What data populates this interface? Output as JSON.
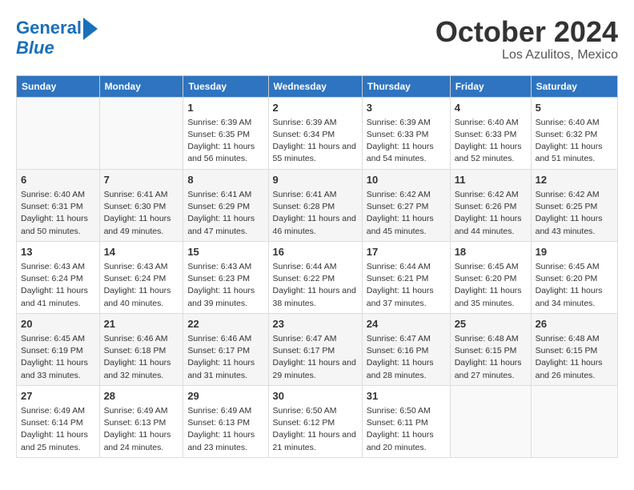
{
  "logo": {
    "line1": "General",
    "line2": "Blue"
  },
  "title": "October 2024",
  "subtitle": "Los Azulitos, Mexico",
  "days_of_week": [
    "Sunday",
    "Monday",
    "Tuesday",
    "Wednesday",
    "Thursday",
    "Friday",
    "Saturday"
  ],
  "weeks": [
    [
      {
        "day": "",
        "info": ""
      },
      {
        "day": "",
        "info": ""
      },
      {
        "day": "1",
        "info": "Sunrise: 6:39 AM\nSunset: 6:35 PM\nDaylight: 11 hours and 56 minutes."
      },
      {
        "day": "2",
        "info": "Sunrise: 6:39 AM\nSunset: 6:34 PM\nDaylight: 11 hours and 55 minutes."
      },
      {
        "day": "3",
        "info": "Sunrise: 6:39 AM\nSunset: 6:33 PM\nDaylight: 11 hours and 54 minutes."
      },
      {
        "day": "4",
        "info": "Sunrise: 6:40 AM\nSunset: 6:33 PM\nDaylight: 11 hours and 52 minutes."
      },
      {
        "day": "5",
        "info": "Sunrise: 6:40 AM\nSunset: 6:32 PM\nDaylight: 11 hours and 51 minutes."
      }
    ],
    [
      {
        "day": "6",
        "info": "Sunrise: 6:40 AM\nSunset: 6:31 PM\nDaylight: 11 hours and 50 minutes."
      },
      {
        "day": "7",
        "info": "Sunrise: 6:41 AM\nSunset: 6:30 PM\nDaylight: 11 hours and 49 minutes."
      },
      {
        "day": "8",
        "info": "Sunrise: 6:41 AM\nSunset: 6:29 PM\nDaylight: 11 hours and 47 minutes."
      },
      {
        "day": "9",
        "info": "Sunrise: 6:41 AM\nSunset: 6:28 PM\nDaylight: 11 hours and 46 minutes."
      },
      {
        "day": "10",
        "info": "Sunrise: 6:42 AM\nSunset: 6:27 PM\nDaylight: 11 hours and 45 minutes."
      },
      {
        "day": "11",
        "info": "Sunrise: 6:42 AM\nSunset: 6:26 PM\nDaylight: 11 hours and 44 minutes."
      },
      {
        "day": "12",
        "info": "Sunrise: 6:42 AM\nSunset: 6:25 PM\nDaylight: 11 hours and 43 minutes."
      }
    ],
    [
      {
        "day": "13",
        "info": "Sunrise: 6:43 AM\nSunset: 6:24 PM\nDaylight: 11 hours and 41 minutes."
      },
      {
        "day": "14",
        "info": "Sunrise: 6:43 AM\nSunset: 6:24 PM\nDaylight: 11 hours and 40 minutes."
      },
      {
        "day": "15",
        "info": "Sunrise: 6:43 AM\nSunset: 6:23 PM\nDaylight: 11 hours and 39 minutes."
      },
      {
        "day": "16",
        "info": "Sunrise: 6:44 AM\nSunset: 6:22 PM\nDaylight: 11 hours and 38 minutes."
      },
      {
        "day": "17",
        "info": "Sunrise: 6:44 AM\nSunset: 6:21 PM\nDaylight: 11 hours and 37 minutes."
      },
      {
        "day": "18",
        "info": "Sunrise: 6:45 AM\nSunset: 6:20 PM\nDaylight: 11 hours and 35 minutes."
      },
      {
        "day": "19",
        "info": "Sunrise: 6:45 AM\nSunset: 6:20 PM\nDaylight: 11 hours and 34 minutes."
      }
    ],
    [
      {
        "day": "20",
        "info": "Sunrise: 6:45 AM\nSunset: 6:19 PM\nDaylight: 11 hours and 33 minutes."
      },
      {
        "day": "21",
        "info": "Sunrise: 6:46 AM\nSunset: 6:18 PM\nDaylight: 11 hours and 32 minutes."
      },
      {
        "day": "22",
        "info": "Sunrise: 6:46 AM\nSunset: 6:17 PM\nDaylight: 11 hours and 31 minutes."
      },
      {
        "day": "23",
        "info": "Sunrise: 6:47 AM\nSunset: 6:17 PM\nDaylight: 11 hours and 29 minutes."
      },
      {
        "day": "24",
        "info": "Sunrise: 6:47 AM\nSunset: 6:16 PM\nDaylight: 11 hours and 28 minutes."
      },
      {
        "day": "25",
        "info": "Sunrise: 6:48 AM\nSunset: 6:15 PM\nDaylight: 11 hours and 27 minutes."
      },
      {
        "day": "26",
        "info": "Sunrise: 6:48 AM\nSunset: 6:15 PM\nDaylight: 11 hours and 26 minutes."
      }
    ],
    [
      {
        "day": "27",
        "info": "Sunrise: 6:49 AM\nSunset: 6:14 PM\nDaylight: 11 hours and 25 minutes."
      },
      {
        "day": "28",
        "info": "Sunrise: 6:49 AM\nSunset: 6:13 PM\nDaylight: 11 hours and 24 minutes."
      },
      {
        "day": "29",
        "info": "Sunrise: 6:49 AM\nSunset: 6:13 PM\nDaylight: 11 hours and 23 minutes."
      },
      {
        "day": "30",
        "info": "Sunrise: 6:50 AM\nSunset: 6:12 PM\nDaylight: 11 hours and 21 minutes."
      },
      {
        "day": "31",
        "info": "Sunrise: 6:50 AM\nSunset: 6:11 PM\nDaylight: 11 hours and 20 minutes."
      },
      {
        "day": "",
        "info": ""
      },
      {
        "day": "",
        "info": ""
      }
    ]
  ]
}
